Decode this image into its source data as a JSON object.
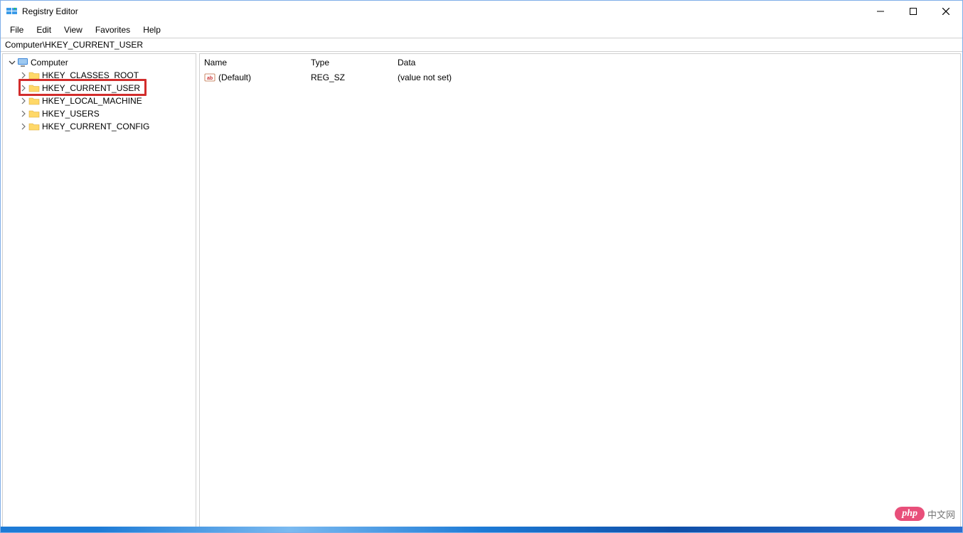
{
  "title": "Registry Editor",
  "menubar": [
    "File",
    "Edit",
    "View",
    "Favorites",
    "Help"
  ],
  "address": "Computer\\HKEY_CURRENT_USER",
  "tree": {
    "root": "Computer",
    "hives": [
      "HKEY_CLASSES_ROOT",
      "HKEY_CURRENT_USER",
      "HKEY_LOCAL_MACHINE",
      "HKEY_USERS",
      "HKEY_CURRENT_CONFIG"
    ],
    "highlighted_index": 1
  },
  "list": {
    "columns": [
      "Name",
      "Type",
      "Data"
    ],
    "rows": [
      {
        "name": "(Default)",
        "type": "REG_SZ",
        "data": "(value not set)"
      }
    ]
  },
  "watermark": {
    "pill": "php",
    "text": "中文网"
  }
}
